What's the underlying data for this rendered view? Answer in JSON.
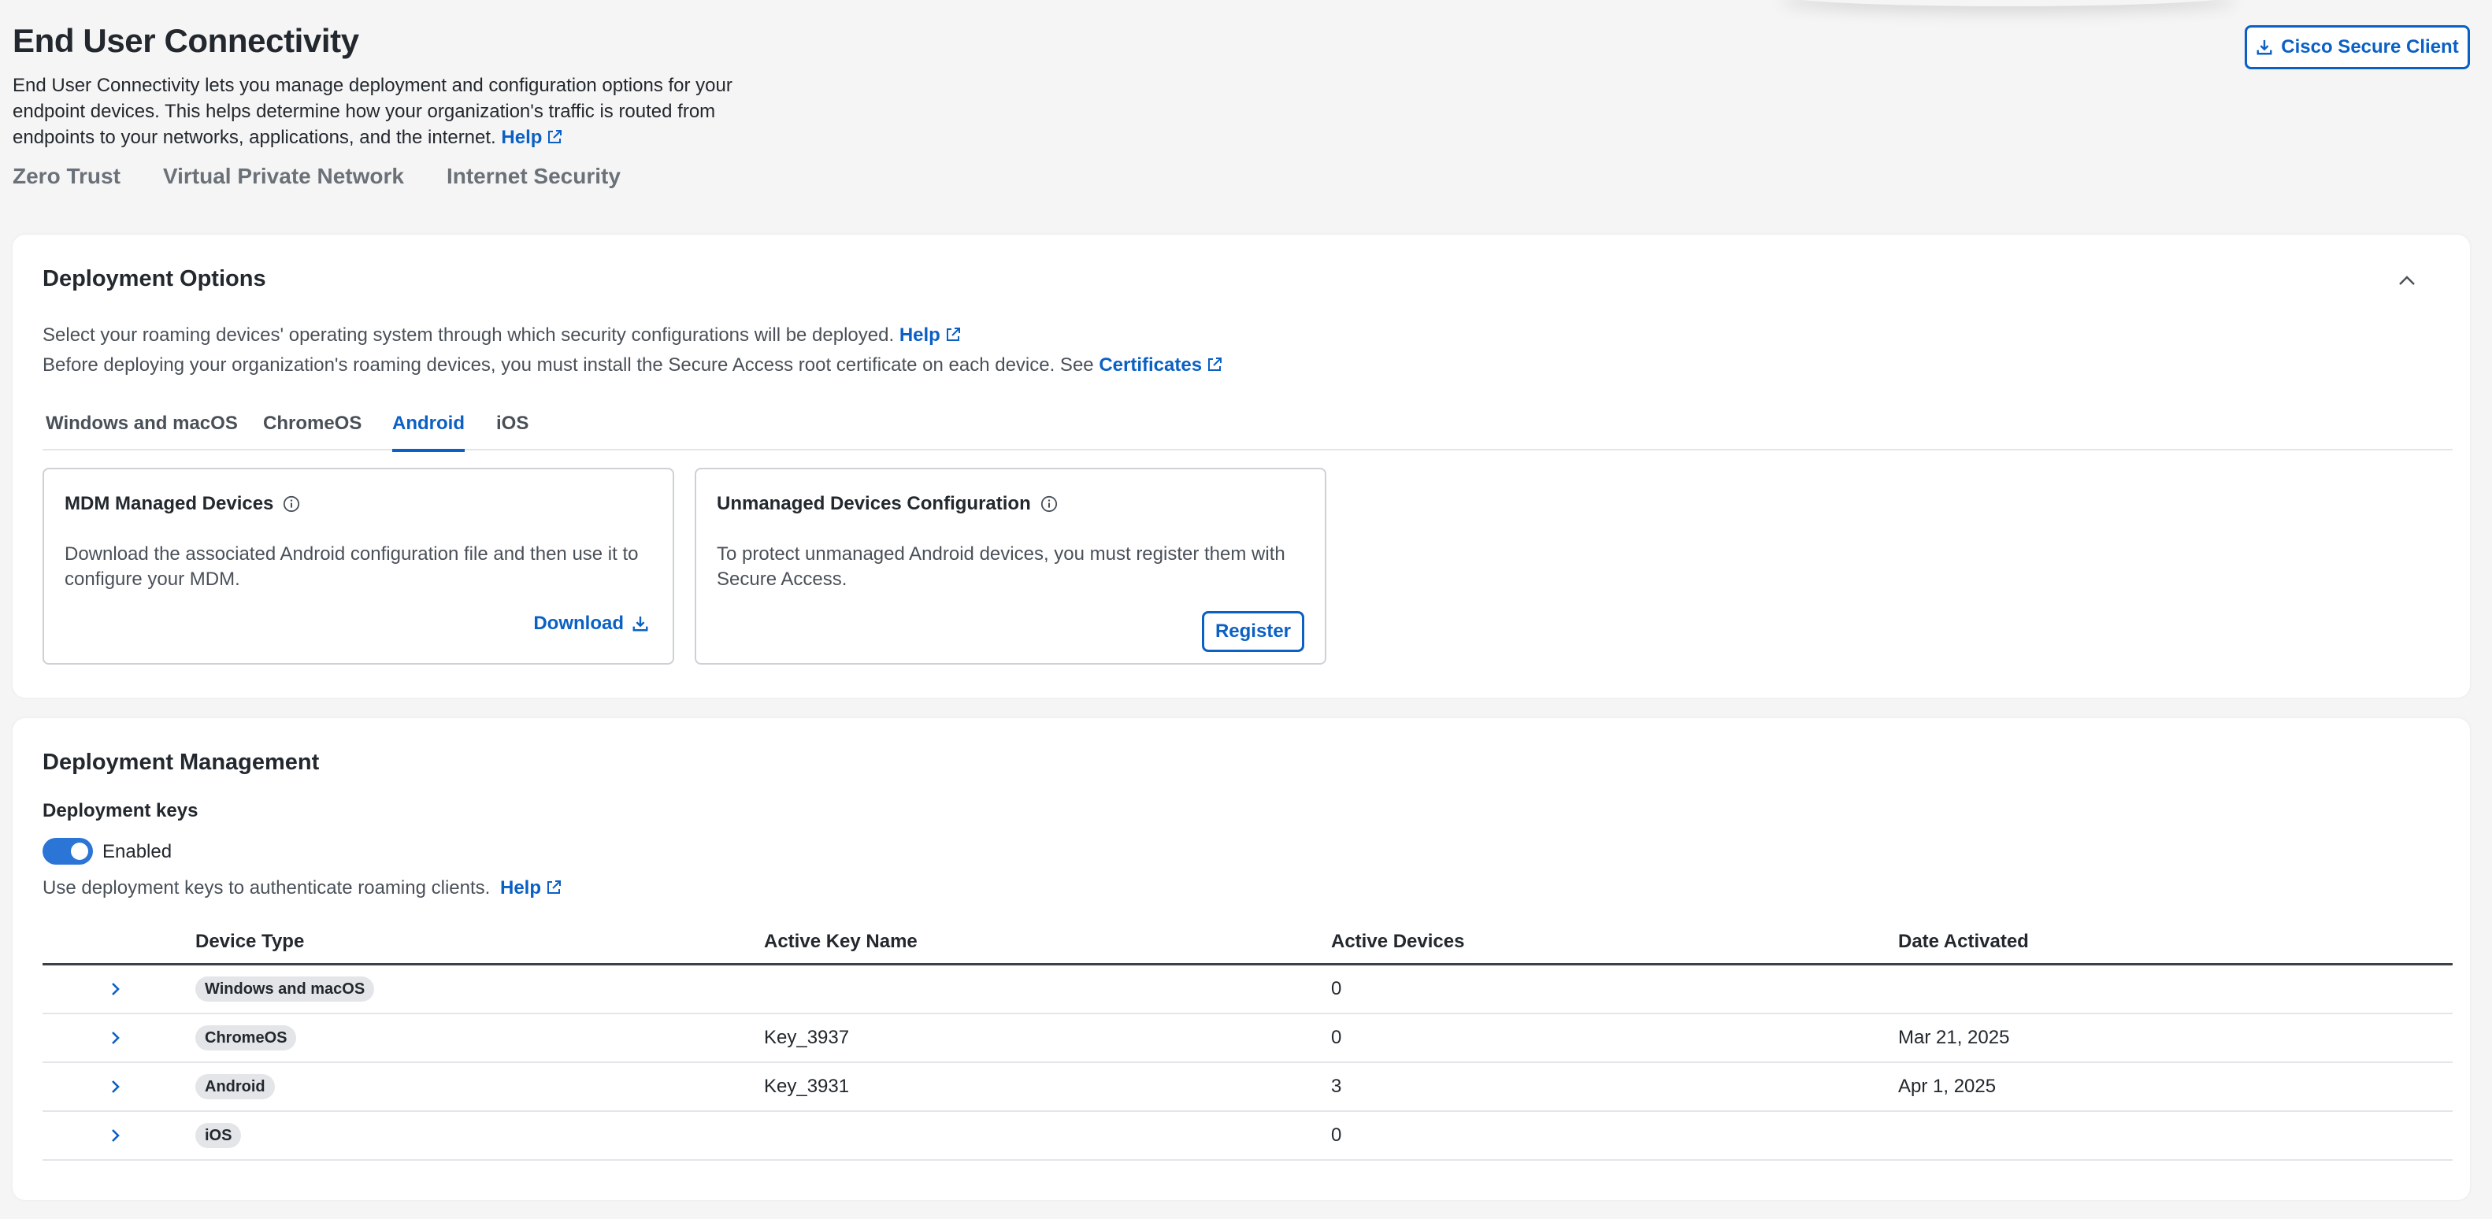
{
  "header": {
    "title": "End User Connectivity",
    "description": "End User Connectivity lets you manage deployment and configuration options for your endpoint devices. This helps determine how your organization's traffic is routed from endpoints to your networks, applications, and the internet.",
    "help_label": "Help",
    "cisco_button_label": "Cisco Secure Client"
  },
  "top_tabs": [
    {
      "label": "Zero Trust"
    },
    {
      "label": "Virtual Private Network"
    },
    {
      "label": "Internet Security"
    }
  ],
  "deployment_options": {
    "title": "Deployment Options",
    "line1": "Select your roaming devices' operating system through which security configurations will be deployed.",
    "line1_link": "Help",
    "line2": "Before deploying your organization's roaming devices, you must install the Secure Access root certificate on each device. See",
    "line2_link": "Certificates",
    "os_tabs": [
      {
        "label": "Windows and macOS"
      },
      {
        "label": "ChromeOS"
      },
      {
        "label": "Android"
      },
      {
        "label": "iOS"
      }
    ],
    "active_tab": "Android",
    "mdm": {
      "title": "MDM Managed Devices",
      "text": "Download the associated Android configuration file and then use it to configure your MDM.",
      "action": "Download"
    },
    "unmanaged": {
      "title": "Unmanaged Devices Configuration",
      "text": "To protect unmanaged Android devices, you must register them with Secure Access.",
      "action": "Register"
    }
  },
  "deployment_management": {
    "title": "Deployment Management",
    "keys_title": "Deployment keys",
    "toggle_label": "Enabled",
    "toggle_on": true,
    "help_text": "Use deployment keys to authenticate roaming clients.",
    "help_link": "Help",
    "columns": [
      "Device Type",
      "Active Key Name",
      "Active Devices",
      "Date Activated"
    ],
    "rows": [
      {
        "device": "Windows and macOS",
        "key": "",
        "active": "0",
        "date": ""
      },
      {
        "device": "ChromeOS",
        "key": "Key_3937",
        "active": "0",
        "date": "Mar 21, 2025"
      },
      {
        "device": "Android",
        "key": "Key_3931",
        "active": "3",
        "date": "Apr 1, 2025"
      },
      {
        "device": "iOS",
        "key": "",
        "active": "0",
        "date": ""
      }
    ]
  },
  "colors": {
    "accent": "#0a60c4",
    "toggle": "#2a75d6",
    "background": "#f5f5f5"
  }
}
